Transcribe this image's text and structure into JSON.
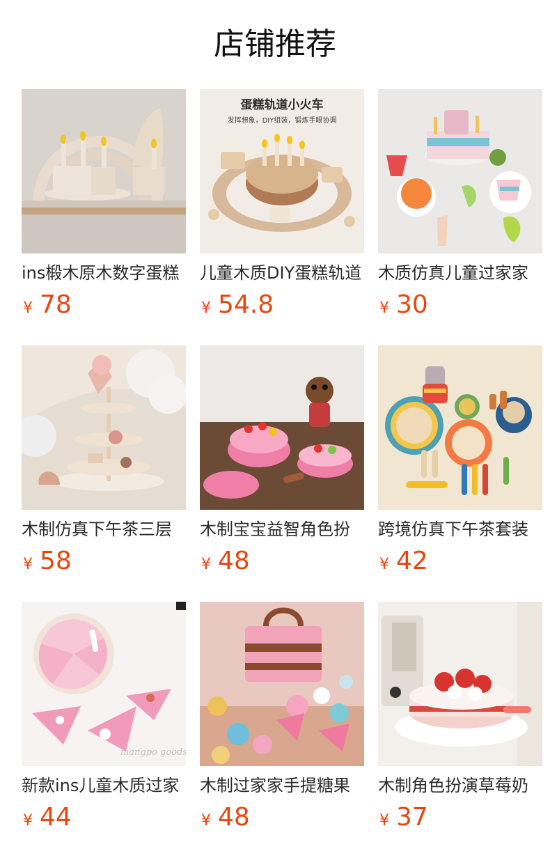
{
  "header": {
    "title": "店铺推荐"
  },
  "products": [
    {
      "name": "ins椴木原木数字蛋糕",
      "currency": "¥",
      "price": "78",
      "image_icon": "wooden-birthday-cake-icon",
      "image_text": ""
    },
    {
      "name": "儿童木质DIY蛋糕轨道",
      "currency": "¥",
      "price": "54.8",
      "image_icon": "cake-train-icon",
      "image_text": "蛋糕轨道小火车",
      "image_subtext": "发挥想象，DIY组装，锻炼手眼协调"
    },
    {
      "name": "木质仿真儿童过家家",
      "currency": "¥",
      "price": "30",
      "image_icon": "number-cake-set-icon",
      "image_text": ""
    },
    {
      "name": "木制仿真下午茶三层",
      "currency": "¥",
      "price": "58",
      "image_icon": "tea-stand-icon",
      "image_text": ""
    },
    {
      "name": "木制宝宝益智角色扮",
      "currency": "¥",
      "price": "48",
      "image_icon": "pink-cake-icon",
      "image_text": ""
    },
    {
      "name": "跨境仿真下午茶套装",
      "currency": "¥",
      "price": "42",
      "image_icon": "tea-set-icon",
      "image_text": ""
    },
    {
      "name": "新款ins儿童木质过家",
      "currency": "¥",
      "price": "44",
      "image_icon": "pink-slice-cake-icon",
      "image_text": "mangpo goods"
    },
    {
      "name": "木制过家家手提糖果",
      "currency": "¥",
      "price": "48",
      "image_icon": "candy-box-icon",
      "image_text": ""
    },
    {
      "name": "木制角色扮演草莓奶",
      "currency": "¥",
      "price": "37",
      "image_icon": "strawberry-cake-icon",
      "image_text": ""
    }
  ]
}
